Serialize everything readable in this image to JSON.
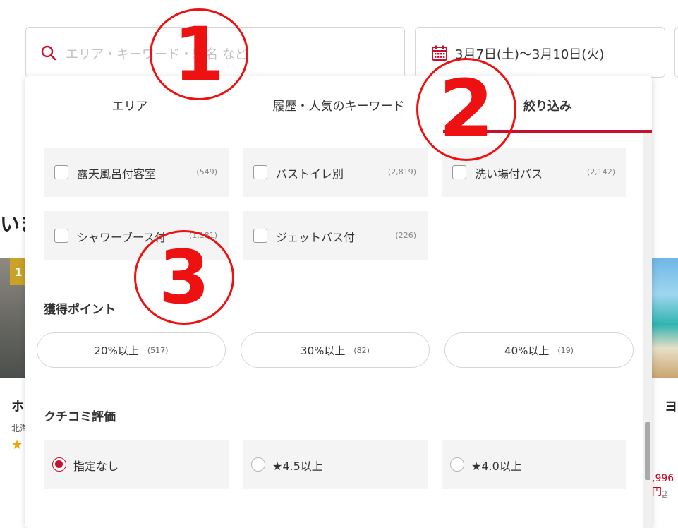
{
  "search": {
    "placeholder": "エリア・キーワード・駅名 など",
    "dates": "3月7日(土)〜3月10日(火)"
  },
  "background": {
    "heading_fragment": "いま",
    "rank_badge": "1",
    "card_left_title": "ホ",
    "card_left_area": "北海",
    "card_left_stars": "★",
    "card_right_title": "ヨ",
    "card_right_price": ",996円",
    "card_right_old_price": "2"
  },
  "tabs": [
    {
      "label": "エリア",
      "active": false
    },
    {
      "label": "履歴・人気のキーワード",
      "active": false
    },
    {
      "label": "絞り込み",
      "active": true
    }
  ],
  "bath_options": [
    {
      "label": "露天風呂付客室",
      "count": "(549)"
    },
    {
      "label": "バストイレ別",
      "count": "(2,819)"
    },
    {
      "label": "洗い場付バス",
      "count": "(2,142)"
    },
    {
      "label": "シャワーブース付",
      "count": "(1,181)"
    },
    {
      "label": "ジェットバス付",
      "count": "(226)"
    }
  ],
  "points": {
    "title": "獲得ポイント",
    "options": [
      {
        "label": "20%以上",
        "count": "(517)"
      },
      {
        "label": "30%以上",
        "count": "(82)"
      },
      {
        "label": "40%以上",
        "count": "(19)"
      }
    ]
  },
  "reviews": {
    "title": "クチコミ評価",
    "options": [
      {
        "label": "指定なし",
        "selected": true
      },
      {
        "label": "★4.5以上",
        "selected": false
      },
      {
        "label": "★4.0以上",
        "selected": false
      }
    ]
  },
  "annotations": [
    "1",
    "2",
    "3"
  ],
  "colors": {
    "accent": "#c8102e",
    "annotation": "#ee1111",
    "option_bg": "#f4f4f4"
  }
}
